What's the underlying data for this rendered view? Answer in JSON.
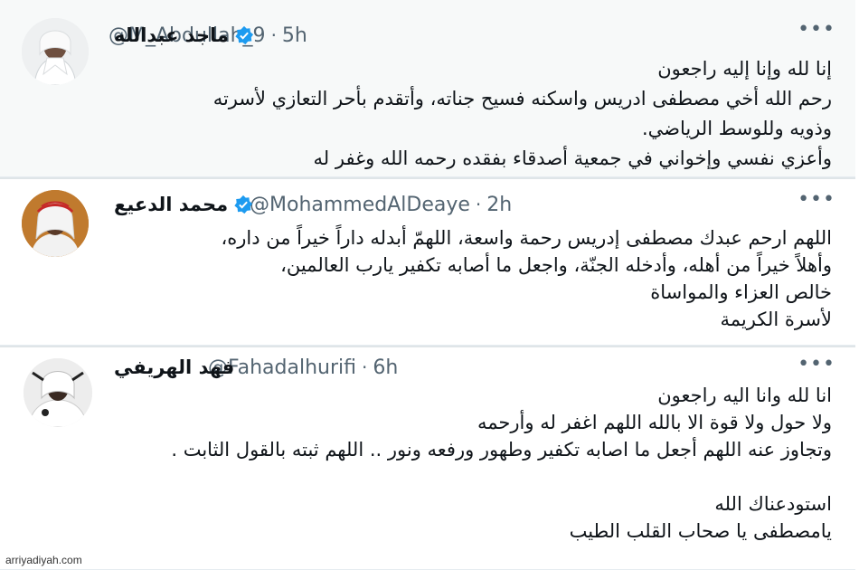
{
  "tweets": [
    {
      "name": "ماجد عبدالله",
      "handle": "@M_Abdullah_9",
      "time": "5h",
      "more": "•••",
      "lines": [
        "إنا لله وإنا إليه راجعون",
        "رحم الله أخي مصطفى ادريس واسكنه فسيح جناته، وأتقدم بأحر التعازي لأسرته",
        "وذويه وللوسط الرياضي.",
        "وأعزي نفسي وإخواني في جمعية أصدقاء بفقده رحمه الله وغفر له"
      ]
    },
    {
      "name": "محمد الدعيع",
      "handle": "@MohammedAlDeaye",
      "time": "2h",
      "more": "•••",
      "lines": [
        "اللهم ارحم عبدك مصطفى إدريس رحمة واسعة، اللهمّ أبدله داراً خيراً من داره،",
        "وأهلاً خيراً من أهله، وأدخله الجنّة، واجعل ما أصابه تكفير يارب العالمين،",
        "خالص العزاء والمواساة",
        "لأسرة الكريمة"
      ]
    },
    {
      "name": "فهد الهريفي",
      "handle": "@Fahadalhurifi",
      "time": "6h",
      "more": "•••",
      "lines": [
        "انا لله وانا اليه راجعون",
        "ولا حول ولا قوة الا بالله اللهم اغفر له وأرحمه",
        "وتجاوز عنه اللهم أجعل ما اصابه تكفير وطهور ورفعه ونور .. اللهم ثبته بالقول الثابت .",
        "",
        "استودعناك الله",
        "يامصطفى يا صحاب القلب الطيب"
      ]
    }
  ],
  "watermark": "arriyadiyah.com",
  "colors": {
    "verified": "#1d9bf0",
    "muted": "#536471",
    "text": "#0f1419"
  }
}
